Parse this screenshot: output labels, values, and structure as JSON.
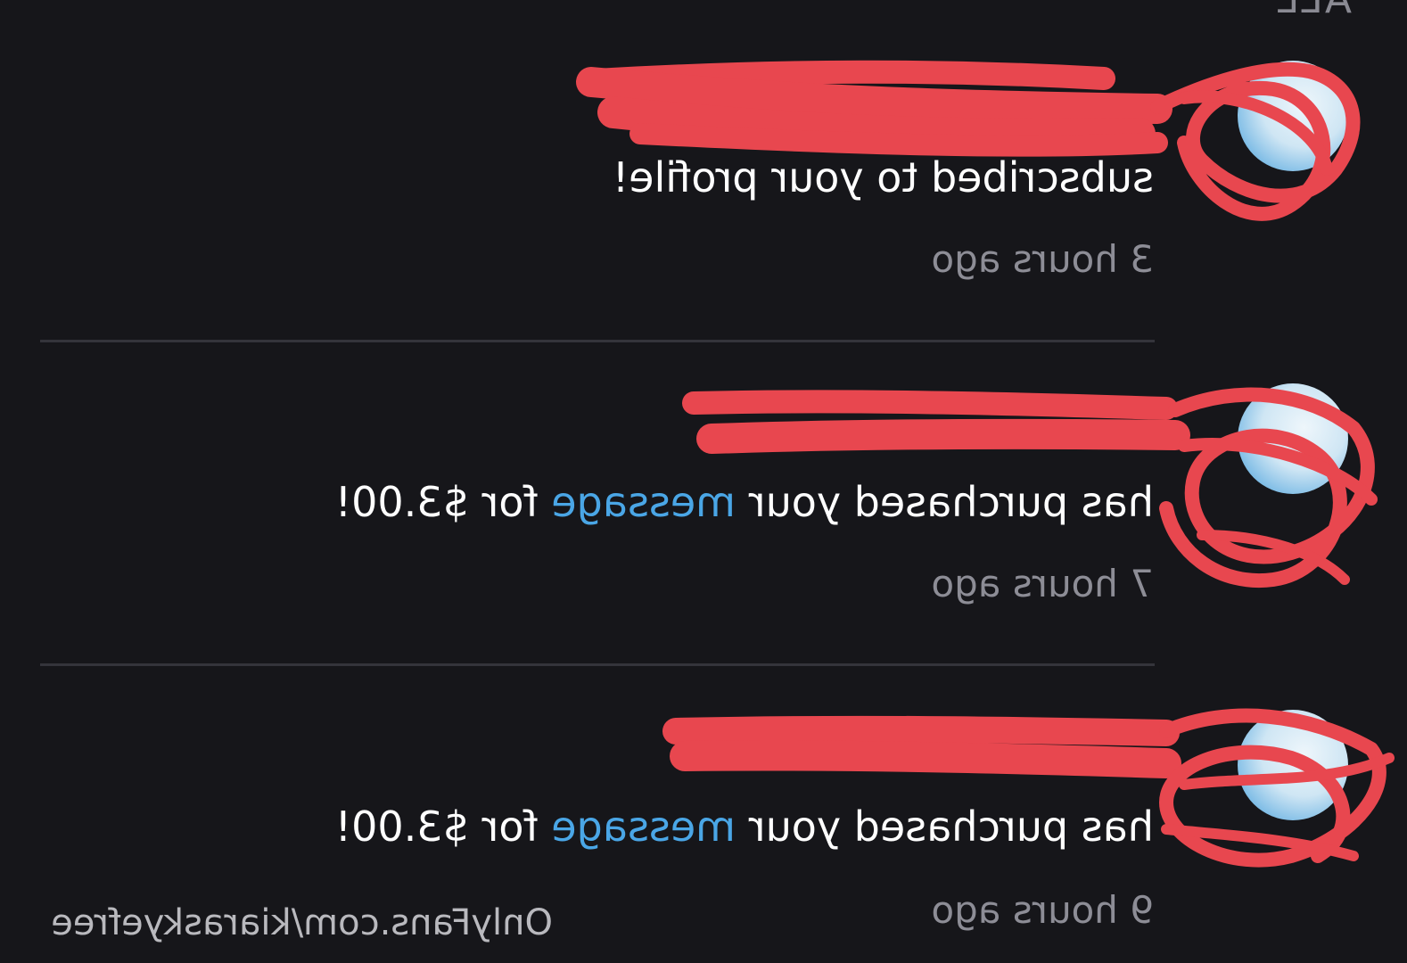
{
  "filter_tab": "ALL",
  "notifications": [
    {
      "user": "",
      "message_prefix": "subscribed to your profile!",
      "link_text": "",
      "message_suffix": "",
      "time": "3 hours ago"
    },
    {
      "user": "",
      "message_prefix": "has purchased your",
      "link_text": "message",
      "message_suffix": "for $3.00!",
      "time": "7 hours ago"
    },
    {
      "user": "",
      "message_prefix": "has purchased your",
      "link_text": "message",
      "message_suffix": "for $3.00!",
      "time": "9 hours ago"
    }
  ],
  "watermark": "OnlyFans.com/kiaraskyefree",
  "colors": {
    "background": "#16161a",
    "link": "#4aa6e6",
    "text": "#ffffff",
    "muted": "#8d8d96",
    "redaction": "#e8474f"
  }
}
